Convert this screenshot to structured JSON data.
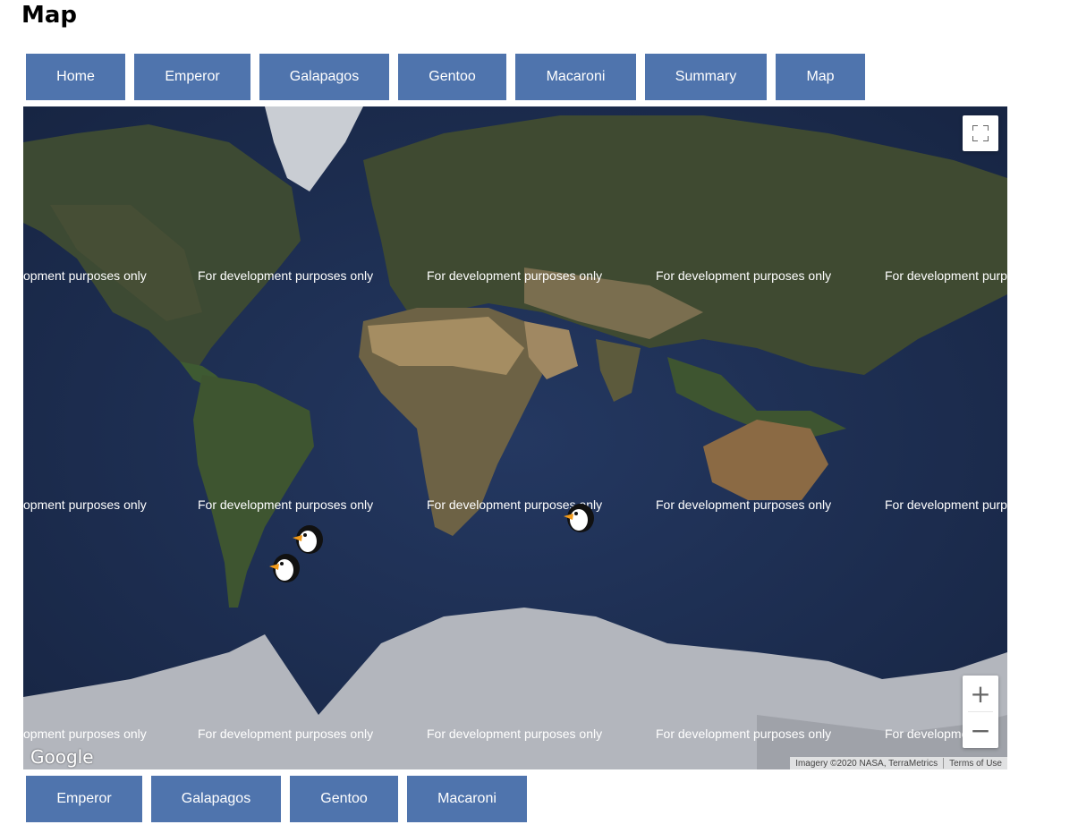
{
  "page": {
    "title": "Map"
  },
  "nav_top": [
    {
      "label": "Home"
    },
    {
      "label": "Emperor"
    },
    {
      "label": "Galapagos"
    },
    {
      "label": "Gentoo"
    },
    {
      "label": "Macaroni"
    },
    {
      "label": "Summary"
    },
    {
      "label": "Map"
    }
  ],
  "map": {
    "watermark": "For development purposes only",
    "watermark_cut_left": "opment purposes only",
    "watermark_cut_right": "For development purp",
    "watermark_cut_bottom_right": "For developme",
    "logo": "Google",
    "attribution": "Imagery ©2020 NASA, TerraMetrics",
    "terms": "Terms of Use",
    "zoom_in": "+",
    "zoom_out": "−",
    "fullscreen_icon": "fullscreen-icon",
    "marker_icon": "penguin-icon",
    "colors": {
      "ocean": "#1d2c4b",
      "land": "#3e4a2f",
      "desert": "#9b8560",
      "ice": "#b5b8bf"
    }
  },
  "nav_bottom": [
    {
      "label": "Emperor"
    },
    {
      "label": "Galapagos"
    },
    {
      "label": "Gentoo"
    },
    {
      "label": "Macaroni"
    }
  ],
  "colors": {
    "button": "#4f74ad",
    "button_text": "#ffffff"
  }
}
